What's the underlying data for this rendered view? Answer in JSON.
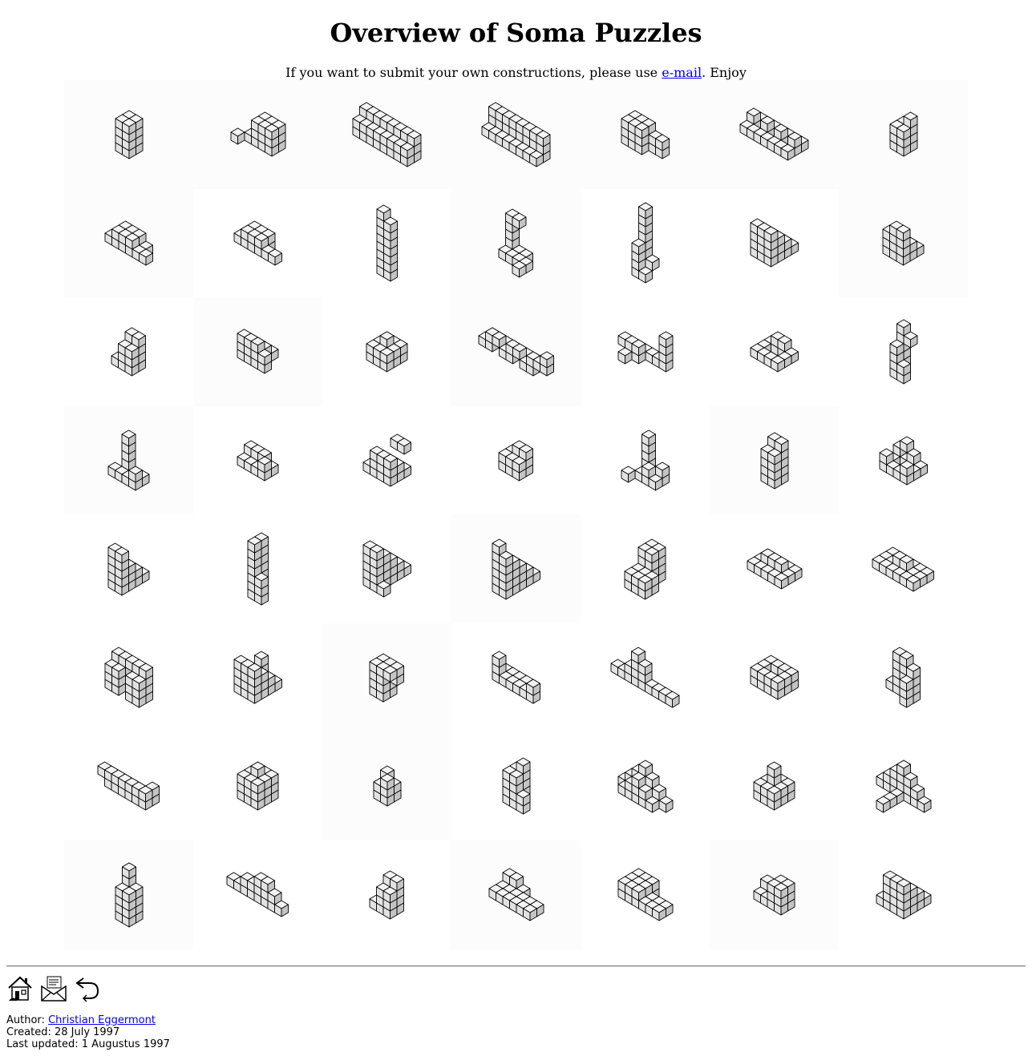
{
  "page": {
    "title": "Overview of Soma Puzzles",
    "intro_before": "If you want to submit your own constructions, please use ",
    "intro_link": "e-mail",
    "intro_after": ". Enjoy"
  },
  "colors": {
    "cube_top": "#f4f4f4",
    "cube_left": "#e2e2e2",
    "cube_right": "#c4c4c4",
    "cube_edge": "#000000",
    "link": "#0000ee",
    "cell_tint": "#fbfcfb"
  },
  "navigation": {
    "icons": [
      "home-icon",
      "mail-icon",
      "back-icon"
    ]
  },
  "footer": {
    "author_label": "Author: ",
    "author_name": "Christian Eggermont",
    "created": "Created: 28 July 1997",
    "updated": "Last updated: 1 Augustus 1997"
  }
}
